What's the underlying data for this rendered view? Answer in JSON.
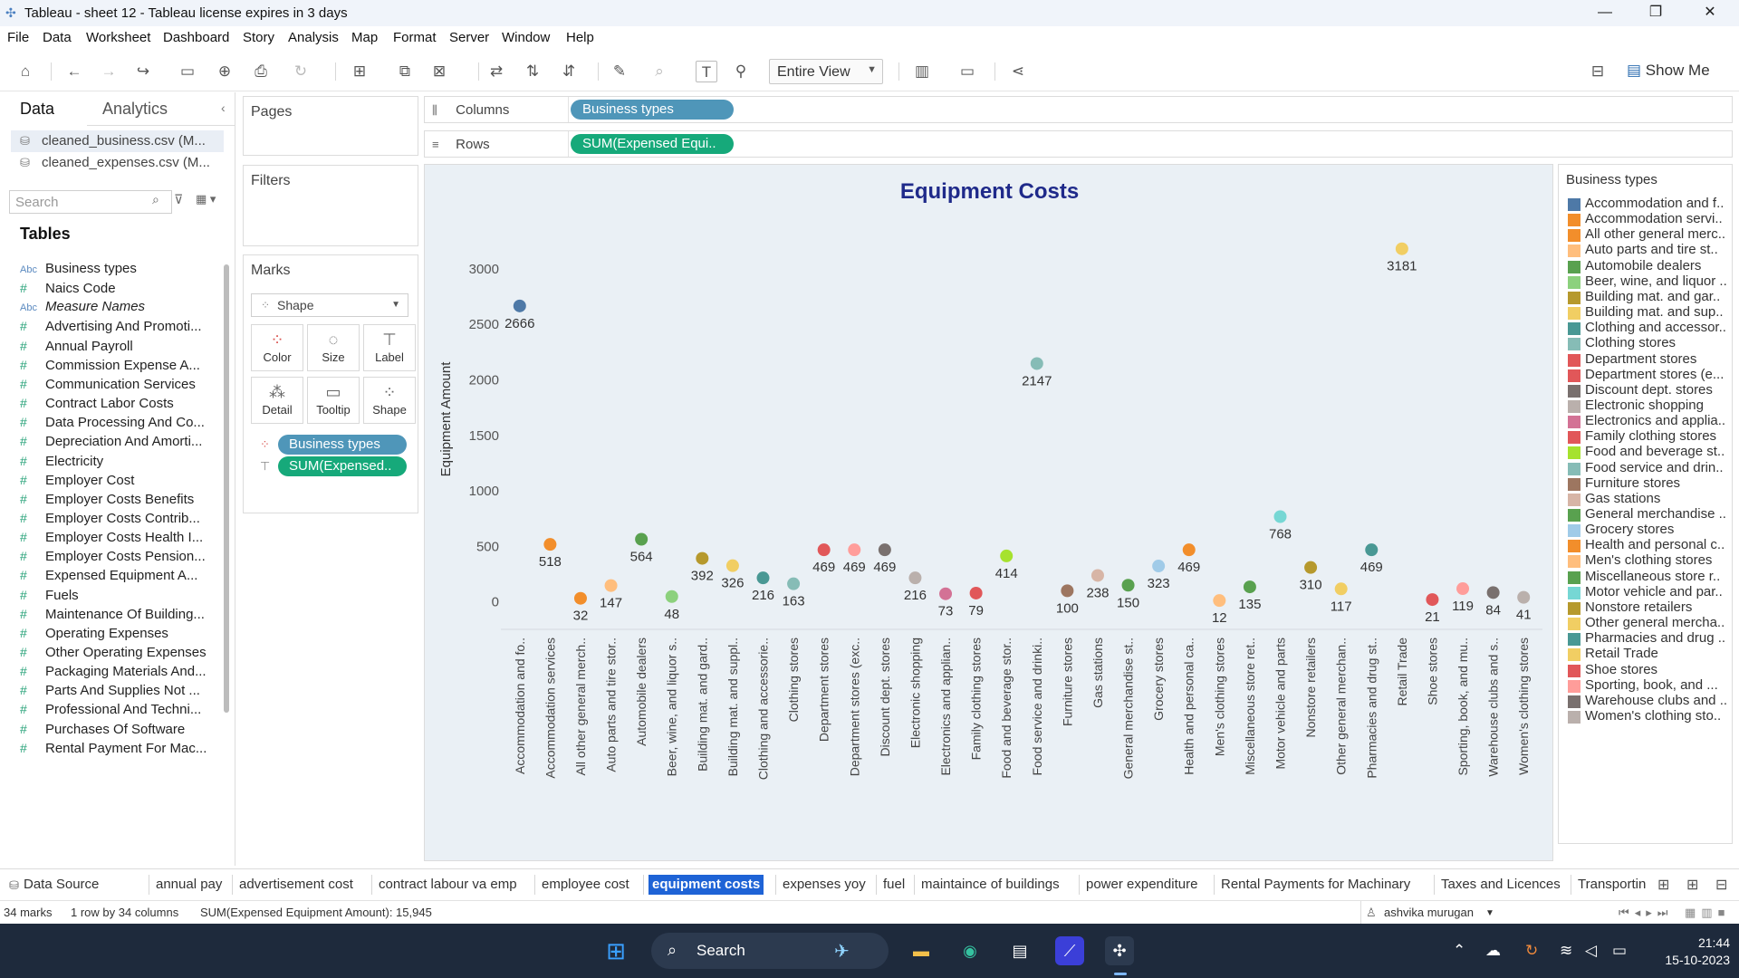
{
  "window": {
    "title": "Tableau - sheet 12 - Tableau license expires in 3 days",
    "controls": [
      "—",
      "❐",
      "✕"
    ]
  },
  "menu": [
    "File",
    "Data",
    "Worksheet",
    "Dashboard",
    "Story",
    "Analysis",
    "Map",
    "Format",
    "Server",
    "Window",
    "Help"
  ],
  "toolbar": {
    "fit_value": "Entire View",
    "show_me": "Show Me"
  },
  "data_pane": {
    "tabs": [
      "Data",
      "Analytics"
    ],
    "datasources": [
      "cleaned_business.csv (M...",
      "cleaned_expenses.csv (M..."
    ],
    "search_placeholder": "Search",
    "tables_heading": "Tables",
    "fields": [
      {
        "type": "Abc",
        "name": "Business types",
        "kind": "dim"
      },
      {
        "type": "#",
        "name": "Naics Code",
        "kind": "measure"
      },
      {
        "type": "Abc",
        "name": "Measure Names",
        "kind": "dim",
        "italic": true
      },
      {
        "type": "#",
        "name": "Advertising And Promoti...",
        "kind": "measure"
      },
      {
        "type": "#",
        "name": "Annual Payroll",
        "kind": "measure"
      },
      {
        "type": "#",
        "name": "Commission Expense A...",
        "kind": "measure"
      },
      {
        "type": "#",
        "name": "Communication Services",
        "kind": "measure"
      },
      {
        "type": "#",
        "name": "Contract Labor Costs",
        "kind": "measure"
      },
      {
        "type": "#",
        "name": "Data Processing And Co...",
        "kind": "measure"
      },
      {
        "type": "#",
        "name": "Depreciation And Amorti...",
        "kind": "measure"
      },
      {
        "type": "#",
        "name": "Electricity",
        "kind": "measure"
      },
      {
        "type": "#",
        "name": "Employer Cost",
        "kind": "measure"
      },
      {
        "type": "#",
        "name": "Employer Costs Benefits",
        "kind": "measure"
      },
      {
        "type": "#",
        "name": "Employer Costs Contrib...",
        "kind": "measure"
      },
      {
        "type": "#",
        "name": "Employer Costs Health I...",
        "kind": "measure"
      },
      {
        "type": "#",
        "name": "Employer Costs Pension...",
        "kind": "measure"
      },
      {
        "type": "#",
        "name": "Expensed Equipment A...",
        "kind": "measure"
      },
      {
        "type": "#",
        "name": "Fuels",
        "kind": "measure"
      },
      {
        "type": "#",
        "name": "Maintenance Of Building...",
        "kind": "measure"
      },
      {
        "type": "#",
        "name": "Operating Expenses",
        "kind": "measure"
      },
      {
        "type": "#",
        "name": "Other Operating Expenses",
        "kind": "measure"
      },
      {
        "type": "#",
        "name": "Packaging Materials And...",
        "kind": "measure"
      },
      {
        "type": "#",
        "name": "Parts And Supplies Not ...",
        "kind": "measure"
      },
      {
        "type": "#",
        "name": "Professional And Techni...",
        "kind": "measure"
      },
      {
        "type": "#",
        "name": "Purchases Of Software",
        "kind": "measure"
      },
      {
        "type": "#",
        "name": "Rental Payment For Mac...",
        "kind": "measure"
      }
    ]
  },
  "shelves": {
    "pages_label": "Pages",
    "filters_label": "Filters",
    "marks_label": "Marks",
    "mark_type": "Shape",
    "mark_buttons": [
      {
        "label": "Color",
        "icon": "color-icon"
      },
      {
        "label": "Size",
        "icon": "size-icon"
      },
      {
        "label": "Label",
        "icon": "label-icon"
      },
      {
        "label": "Detail",
        "icon": "detail-icon"
      },
      {
        "label": "Tooltip",
        "icon": "tooltip-icon"
      },
      {
        "label": "Shape",
        "icon": "shape-icon"
      }
    ],
    "mark_pills": [
      "Business types",
      "SUM(Expensed.."
    ],
    "columns_label": "Columns",
    "rows_label": "Rows",
    "columns_pill": "Business types",
    "rows_pill": "SUM(Expensed Equi.."
  },
  "chart_data": {
    "type": "scatter",
    "title": "Equipment Costs",
    "ylabel": "Equipment Amount",
    "xlabel": "",
    "ylim": [
      -60,
      3350
    ],
    "yticks": [
      0,
      500,
      1000,
      1500,
      2000,
      2500,
      3000
    ],
    "grid": false,
    "legend_placement": "right",
    "categories": [
      "Accommodation and fo..",
      "Accommodation services",
      "All other general merch..",
      "Auto parts and tire stor..",
      "Automobile dealers",
      "Beer, wine, and liquor s..",
      "Building mat. and gard..",
      "Building mat. and suppl..",
      "Clothing and accessorie..",
      "Clothing stores",
      "Department stores",
      "Department stores (exc..",
      "Discount dept. stores",
      "Electronic shopping",
      "Electronics and applian..",
      "Family clothing stores",
      "Food and beverage stor..",
      "Food service and drinki..",
      "Furniture stores",
      "Gas stations",
      "General merchandise st..",
      "Grocery stores",
      "Health and personal ca..",
      "Men's clothing stores",
      "Miscellaneous store ret..",
      "Motor vehicle and parts",
      "Nonstore retailers",
      "Other general merchan..",
      "Pharmacies and drug st..",
      "Retail Trade",
      "Shoe stores",
      "Sporting, book, and mu..",
      "Warehouse clubs and s..",
      "Women's clothing stores"
    ],
    "values": [
      2666,
      518,
      32,
      147,
      564,
      48,
      392,
      326,
      216,
      163,
      469,
      469,
      469,
      216,
      73,
      79,
      414,
      2147,
      100,
      238,
      150,
      323,
      469,
      12,
      135,
      768,
      310,
      117,
      469,
      3181,
      21,
      119,
      84,
      41
    ],
    "colors": [
      "#4e79a7",
      "#f28e2b",
      "#f28e2b",
      "#ffbe7d",
      "#59a14f",
      "#8cd17d",
      "#b6992d",
      "#f1ce63",
      "#499894",
      "#86bcb6",
      "#e15759",
      "#ff9d9a",
      "#79706e",
      "#bab0ac",
      "#d37295",
      "#e15759",
      "#a6e22e",
      "#86bcb6",
      "#9d7660",
      "#d7b5a6",
      "#59a14f",
      "#a0cbe8",
      "#f28e2b",
      "#ffbe7d",
      "#59a14f",
      "#76d7d4",
      "#b6992d",
      "#f1ce63",
      "#499894",
      "#f1ce63",
      "#e15759",
      "#ff9d9a",
      "#79706e",
      "#bab0ac"
    ]
  },
  "legend": {
    "title": "Business types",
    "items": [
      {
        "label": "Accommodation and f..",
        "color": "#4e79a7"
      },
      {
        "label": "Accommodation servi..",
        "color": "#f28e2b"
      },
      {
        "label": "All other general merc..",
        "color": "#f28e2b"
      },
      {
        "label": "Auto parts and tire st..",
        "color": "#ffbe7d"
      },
      {
        "label": "Automobile dealers",
        "color": "#59a14f"
      },
      {
        "label": "Beer, wine, and liquor ..",
        "color": "#8cd17d"
      },
      {
        "label": "Building mat. and gar..",
        "color": "#b6992d"
      },
      {
        "label": "Building mat. and sup..",
        "color": "#f1ce63"
      },
      {
        "label": "Clothing and accessor..",
        "color": "#499894"
      },
      {
        "label": "Clothing stores",
        "color": "#86bcb6"
      },
      {
        "label": "Department stores",
        "color": "#e15759"
      },
      {
        "label": "Department stores (e...",
        "color": "#e15759"
      },
      {
        "label": "Discount dept. stores",
        "color": "#79706e"
      },
      {
        "label": "Electronic shopping",
        "color": "#bab0ac"
      },
      {
        "label": "Electronics and applia..",
        "color": "#d37295"
      },
      {
        "label": "Family clothing stores",
        "color": "#e15759"
      },
      {
        "label": "Food and beverage st..",
        "color": "#a6e22e"
      },
      {
        "label": "Food service and drin..",
        "color": "#86bcb6"
      },
      {
        "label": "Furniture stores",
        "color": "#9d7660"
      },
      {
        "label": "Gas stations",
        "color": "#d7b5a6"
      },
      {
        "label": "General merchandise ..",
        "color": "#59a14f"
      },
      {
        "label": "Grocery stores",
        "color": "#a0cbe8"
      },
      {
        "label": "Health and personal c..",
        "color": "#f28e2b"
      },
      {
        "label": "Men's clothing stores",
        "color": "#ffbe7d"
      },
      {
        "label": "Miscellaneous store r..",
        "color": "#59a14f"
      },
      {
        "label": "Motor vehicle and par..",
        "color": "#76d7d4"
      },
      {
        "label": "Nonstore retailers",
        "color": "#b6992d"
      },
      {
        "label": "Other general mercha..",
        "color": "#f1ce63"
      },
      {
        "label": "Pharmacies and drug ..",
        "color": "#499894"
      },
      {
        "label": "Retail Trade",
        "color": "#f1ce63"
      },
      {
        "label": "Shoe stores",
        "color": "#e15759"
      },
      {
        "label": "Sporting, book, and ...",
        "color": "#ff9d9a"
      },
      {
        "label": "Warehouse clubs and ..",
        "color": "#79706e"
      },
      {
        "label": "Women's clothing sto..",
        "color": "#bab0ac"
      }
    ]
  },
  "sheet_tabs": [
    "Data Source",
    "annual pay",
    "advertisement cost",
    "contract labour va emp",
    "employee cost",
    "equipment costs",
    "expenses yoy",
    "fuel",
    "maintaince of buildings",
    "power expenditure",
    "Rental Payments for Machinary",
    "Taxes and Licences",
    "Transportin"
  ],
  "active_sheet_tab": "equipment costs",
  "status": {
    "marks": "34 marks",
    "dims": "1 row by 34 columns",
    "sum": "SUM(Expensed Equipment Amount): 15,945",
    "user": "ashvika murugan"
  },
  "taskbar": {
    "search": "Search",
    "time": "21:44",
    "date": "15-10-2023"
  }
}
